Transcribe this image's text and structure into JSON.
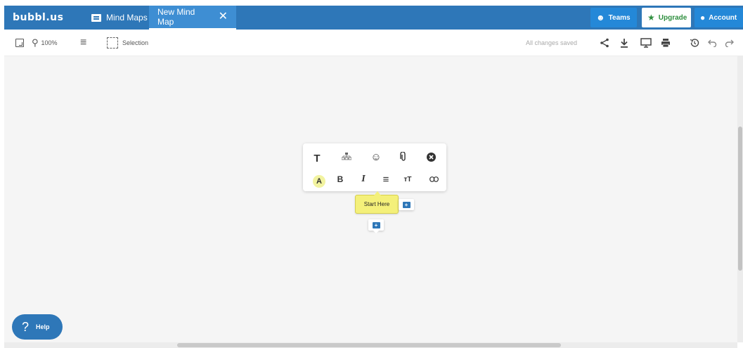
{
  "topbar": {
    "logo": "bubbl.us",
    "tabs": [
      {
        "label": "Mind Maps",
        "icon": "folder-icon"
      },
      {
        "label": "New Mind Map",
        "icon": "close-icon"
      }
    ],
    "teams_label": "Teams",
    "upgrade_label": "Upgrade",
    "account_label": "Account",
    "colors": {
      "bar": "#2e77b8",
      "upgrade_text": "#2f8f3f"
    }
  },
  "toolbar": {
    "zoom": "100%",
    "selection_label": "Selection",
    "status": "All changes saved",
    "icons": [
      "fit-to-screen-icon",
      "zoom-icon",
      "menu-icon",
      "selection-icon",
      "share-icon",
      "download-icon",
      "present-icon",
      "print-icon",
      "history-icon",
      "undo-icon",
      "redo-icon"
    ]
  },
  "format_popup": {
    "row1": [
      "T",
      "⚏",
      "☺",
      "📎",
      "✖"
    ],
    "row2": [
      "A",
      "B",
      "I",
      "≡",
      "тT",
      "⚭"
    ]
  },
  "node": {
    "label": "Start Here",
    "color": "#f4f07a"
  },
  "help": {
    "label": "Help"
  }
}
